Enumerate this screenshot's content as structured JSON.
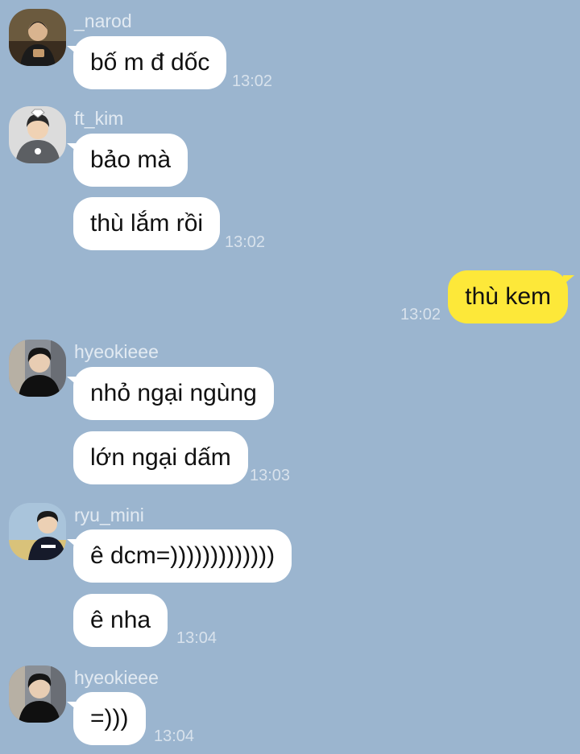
{
  "messages": {
    "g1": {
      "sender": "_narod",
      "bubbles": [
        "bố m đ dốc"
      ],
      "time": "13:02",
      "avatar": "user-photo-icon"
    },
    "g2": {
      "sender": "ft_kim",
      "bubbles": [
        "bảo mà",
        "thù lắm rồi"
      ],
      "time": "13:02",
      "avatar": "user-photo-icon"
    },
    "g3": {
      "bubbles": [
        "thù kem"
      ],
      "time": "13:02"
    },
    "g4": {
      "sender": "hyeokieee",
      "bubbles": [
        "nhỏ ngại ngùng",
        "lớn ngại dấm"
      ],
      "time": "13:03",
      "avatar": "user-photo-icon"
    },
    "g5": {
      "sender": "ryu_mini",
      "bubbles": [
        "ê dcm=)))))))))))))",
        "ê nha"
      ],
      "time": "13:04",
      "avatar": "user-photo-icon"
    },
    "g6": {
      "sender": "hyeokieee",
      "bubbles": [
        "=)))"
      ],
      "time": "13:04",
      "avatar": "user-photo-icon"
    }
  },
  "colors": {
    "background": "#9bb5cf",
    "incoming": "#ffffff",
    "outgoing": "#fde839"
  }
}
